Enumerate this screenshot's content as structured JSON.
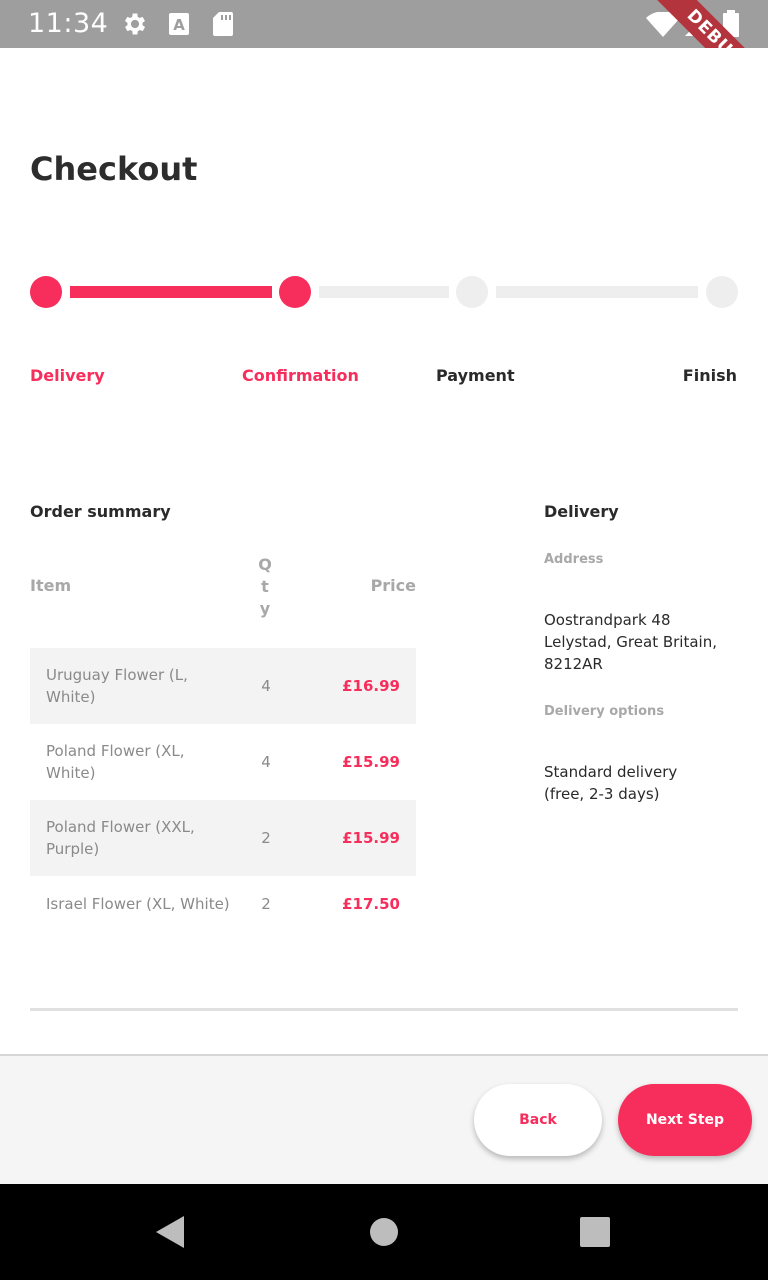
{
  "status_bar": {
    "time": "11:34",
    "icons": [
      "gear-icon",
      "text-a-icon",
      "sd-card-icon",
      "wifi-icon",
      "signal-icon",
      "battery-icon"
    ],
    "debug_banner": "DEBUG"
  },
  "page": {
    "title": "Checkout"
  },
  "stepper": {
    "current_step": 2,
    "steps": [
      {
        "label": "Delivery",
        "completed": true
      },
      {
        "label": "Confirmation",
        "completed": true
      },
      {
        "label": "Payment",
        "completed": false
      },
      {
        "label": "Finish",
        "completed": false
      }
    ]
  },
  "order_summary": {
    "title": "Order summary",
    "columns": {
      "item": "Item",
      "qty": [
        "Q",
        "t",
        "y"
      ],
      "price": "Price"
    },
    "rows": [
      {
        "item": "Uruguay Flower (L, White)",
        "qty": "4",
        "price": "£16.99"
      },
      {
        "item": "Poland Flower (XL, White)",
        "qty": "4",
        "price": "£15.99"
      },
      {
        "item": "Poland Flower (XXL, Purple)",
        "qty": "2",
        "price": "£15.99"
      },
      {
        "item": "Israel Flower (XL, White)",
        "qty": "2",
        "price": "£17.50"
      }
    ]
  },
  "delivery": {
    "title": "Delivery",
    "address_label": "Address",
    "address": "Oostrandpark 48 Lelystad, Great Britain, 8212AR",
    "options_label": "Delivery options",
    "option": "Standard delivery (free, 2-3 days)"
  },
  "actions": {
    "back_label": "Back",
    "next_label": "Next Step"
  },
  "colors": {
    "accent": "#f72d5b",
    "inactive": "#eeeeee",
    "status_bar": "#9e9e9e",
    "debug_ribbon": "#b3343c"
  }
}
